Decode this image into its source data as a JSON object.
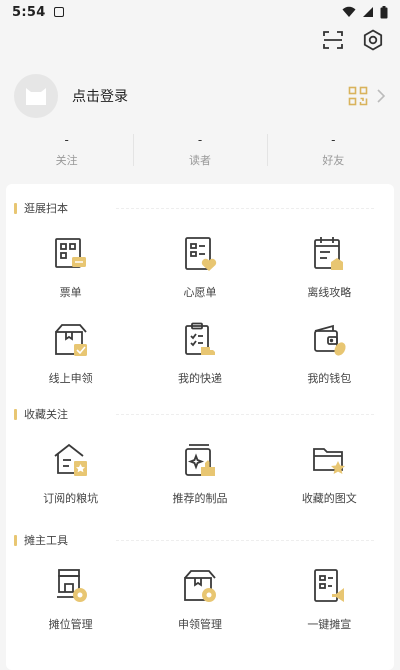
{
  "status_bar": {
    "time": "5:54"
  },
  "profile": {
    "login_text": "点击登录"
  },
  "stats": [
    {
      "value": "-",
      "label": "关注"
    },
    {
      "value": "-",
      "label": "读者"
    },
    {
      "value": "-",
      "label": "好友"
    }
  ],
  "sections": [
    {
      "title": "逛展扫本",
      "items": [
        {
          "label": "票单",
          "icon": "ticket-icon"
        },
        {
          "label": "心愿单",
          "icon": "wishlist-icon"
        },
        {
          "label": "离线攻略",
          "icon": "offline-guide-icon"
        },
        {
          "label": "线上申领",
          "icon": "online-claim-icon"
        },
        {
          "label": "我的快递",
          "icon": "delivery-icon"
        },
        {
          "label": "我的钱包",
          "icon": "wallet-icon"
        }
      ]
    },
    {
      "title": "收藏关注",
      "items": [
        {
          "label": "订阅的粮坑",
          "icon": "subscribed-house-icon"
        },
        {
          "label": "推荐的制品",
          "icon": "recommended-icon"
        },
        {
          "label": "收藏的图文",
          "icon": "favorite-folder-icon"
        }
      ]
    },
    {
      "title": "摊主工具",
      "items": [
        {
          "label": "摊位管理",
          "icon": "booth-manage-icon"
        },
        {
          "label": "申领管理",
          "icon": "claim-manage-icon"
        },
        {
          "label": "一键摊宣",
          "icon": "promote-icon"
        }
      ]
    }
  ],
  "colors": {
    "accent": "#e8c672",
    "icon_stroke": "#3a3a3a"
  }
}
